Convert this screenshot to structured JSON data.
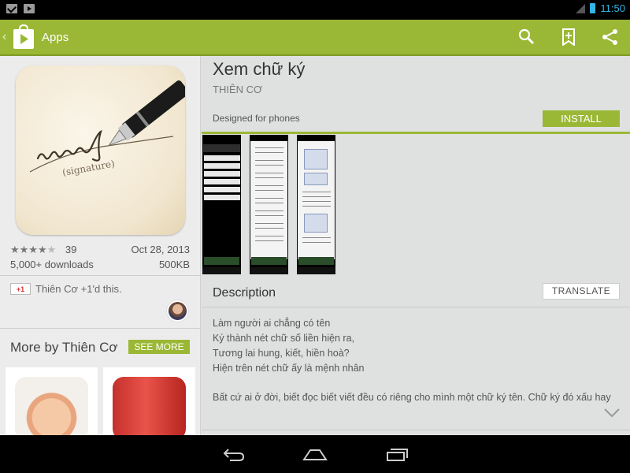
{
  "status_bar": {
    "time": "11:50"
  },
  "action_bar": {
    "title": "Apps",
    "up_glyph": "‹"
  },
  "app": {
    "title": "Xem chữ ký",
    "developer": "THIÊN CƠ",
    "rating_count": "39",
    "rating_stars": 4,
    "date": "Oct 28, 2013",
    "downloads": "5,000+ downloads",
    "size": "500KB",
    "designed_for": "Designed for phones",
    "install_label": "INSTALL"
  },
  "social": {
    "g_label": "+1",
    "plus_one_text": "Thiên Cơ +1'd this."
  },
  "more_by": {
    "title": "More by Thiên Cơ",
    "see_more_label": "SEE MORE"
  },
  "description": {
    "heading": "Description",
    "translate_label": "TRANSLATE",
    "poem": [
      "Làm người ai chẳng có tên",
      "Ký thành nét chữ số liền hiện ra,",
      "Tương lai hung, kiết, hiền hoà?",
      "Hiện trên nét chữ ấy là mệnh nhân"
    ],
    "paragraph": "Bất cứ ai ở đời, biết đọc biết viết đều có riêng cho mình một chữ ký tên. Chữ ký đó xấu hay"
  },
  "icon_art": {
    "signature_text": "(signature)"
  },
  "colors": {
    "accent": "#9ab835",
    "holo_blue": "#33b5e5"
  }
}
